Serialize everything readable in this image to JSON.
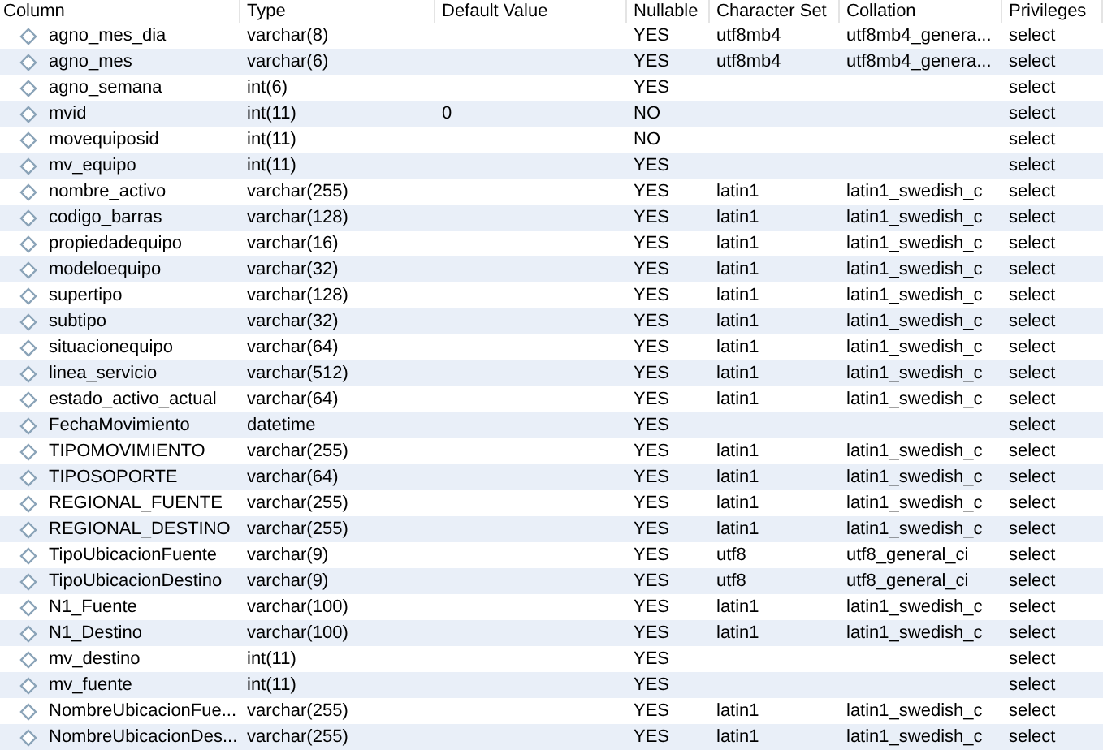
{
  "columns": [
    "Column",
    "Type",
    "Default Value",
    "Nullable",
    "Character Set",
    "Collation",
    "Privileges"
  ],
  "rows": [
    {
      "name": "agno_mes_dia",
      "type": "varchar(8)",
      "nullable": "YES",
      "charset": "utf8mb4",
      "collation": "utf8mb4_genera...",
      "privileges": "select"
    },
    {
      "name": "agno_mes",
      "type": "varchar(6)",
      "nullable": "YES",
      "charset": "utf8mb4",
      "collation": "utf8mb4_genera...",
      "privileges": "select"
    },
    {
      "name": "agno_semana",
      "type": "int(6)",
      "nullable": "YES",
      "privileges": "select"
    },
    {
      "name": "mvid",
      "type": "int(11)",
      "default": "0",
      "nullable": "NO",
      "privileges": "select"
    },
    {
      "name": "movequiposid",
      "type": "int(11)",
      "nullable": "NO",
      "privileges": "select"
    },
    {
      "name": "mv_equipo",
      "type": "int(11)",
      "nullable": "YES",
      "privileges": "select"
    },
    {
      "name": "nombre_activo",
      "type": "varchar(255)",
      "nullable": "YES",
      "charset": "latin1",
      "collation": "latin1_swedish_c",
      "privileges": "select"
    },
    {
      "name": "codigo_barras",
      "type": "varchar(128)",
      "nullable": "YES",
      "charset": "latin1",
      "collation": "latin1_swedish_c",
      "privileges": "select"
    },
    {
      "name": "propiedadequipo",
      "type": "varchar(16)",
      "nullable": "YES",
      "charset": "latin1",
      "collation": "latin1_swedish_c",
      "privileges": "select"
    },
    {
      "name": "modeloequipo",
      "type": "varchar(32)",
      "nullable": "YES",
      "charset": "latin1",
      "collation": "latin1_swedish_c",
      "privileges": "select"
    },
    {
      "name": "supertipo",
      "type": "varchar(128)",
      "nullable": "YES",
      "charset": "latin1",
      "collation": "latin1_swedish_c",
      "privileges": "select"
    },
    {
      "name": "subtipo",
      "type": "varchar(32)",
      "nullable": "YES",
      "charset": "latin1",
      "collation": "latin1_swedish_c",
      "privileges": "select"
    },
    {
      "name": "situacionequipo",
      "type": "varchar(64)",
      "nullable": "YES",
      "charset": "latin1",
      "collation": "latin1_swedish_c",
      "privileges": "select"
    },
    {
      "name": "linea_servicio",
      "type": "varchar(512)",
      "nullable": "YES",
      "charset": "latin1",
      "collation": "latin1_swedish_c",
      "privileges": "select"
    },
    {
      "name": "estado_activo_actual",
      "type": "varchar(64)",
      "nullable": "YES",
      "charset": "latin1",
      "collation": "latin1_swedish_c",
      "privileges": "select"
    },
    {
      "name": "FechaMovimiento",
      "type": "datetime",
      "nullable": "YES",
      "privileges": "select"
    },
    {
      "name": "TIPOMOVIMIENTO",
      "type": "varchar(255)",
      "nullable": "YES",
      "charset": "latin1",
      "collation": "latin1_swedish_c",
      "privileges": "select"
    },
    {
      "name": "TIPOSOPORTE",
      "type": "varchar(64)",
      "nullable": "YES",
      "charset": "latin1",
      "collation": "latin1_swedish_c",
      "privileges": "select"
    },
    {
      "name": "REGIONAL_FUENTE",
      "type": "varchar(255)",
      "nullable": "YES",
      "charset": "latin1",
      "collation": "latin1_swedish_c",
      "privileges": "select"
    },
    {
      "name": "REGIONAL_DESTINO",
      "type": "varchar(255)",
      "nullable": "YES",
      "charset": "latin1",
      "collation": "latin1_swedish_c",
      "privileges": "select"
    },
    {
      "name": "TipoUbicacionFuente",
      "type": "varchar(9)",
      "nullable": "YES",
      "charset": "utf8",
      "collation": "utf8_general_ci",
      "privileges": "select"
    },
    {
      "name": "TipoUbicacionDestino",
      "type": "varchar(9)",
      "nullable": "YES",
      "charset": "utf8",
      "collation": "utf8_general_ci",
      "privileges": "select"
    },
    {
      "name": "N1_Fuente",
      "type": "varchar(100)",
      "nullable": "YES",
      "charset": "latin1",
      "collation": "latin1_swedish_c",
      "privileges": "select"
    },
    {
      "name": "N1_Destino",
      "type": "varchar(100)",
      "nullable": "YES",
      "charset": "latin1",
      "collation": "latin1_swedish_c",
      "privileges": "select"
    },
    {
      "name": "mv_destino",
      "type": "int(11)",
      "nullable": "YES",
      "privileges": "select"
    },
    {
      "name": "mv_fuente",
      "type": "int(11)",
      "nullable": "YES",
      "privileges": "select"
    },
    {
      "name": "NombreUbicacionFue...",
      "type": "varchar(255)",
      "nullable": "YES",
      "charset": "latin1",
      "collation": "latin1_swedish_c",
      "privileges": "select"
    },
    {
      "name": "NombreUbicacionDes...",
      "type": "varchar(255)",
      "nullable": "YES",
      "charset": "latin1",
      "collation": "latin1_swedish_c",
      "privileges": "select"
    }
  ]
}
